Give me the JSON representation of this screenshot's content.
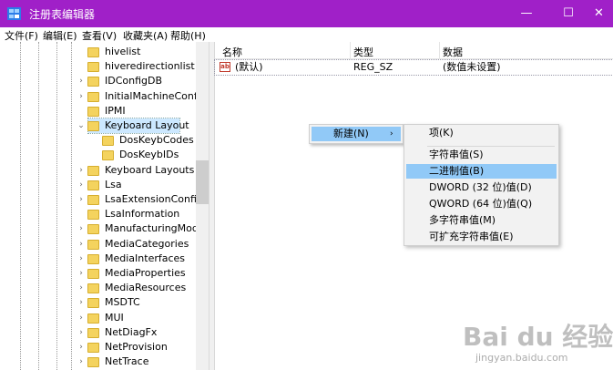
{
  "window": {
    "title": "注册表编辑器",
    "accent_color": "#a020c8",
    "minimize_glyph": "—",
    "maximize_glyph": "☐",
    "close_glyph": "✕"
  },
  "menubar": {
    "items": [
      "文件(F)",
      "编辑(E)",
      "查看(V)",
      "收藏夹(A)",
      "帮助(H)"
    ]
  },
  "tree": {
    "items": [
      {
        "label": "hivelist",
        "has_children": false
      },
      {
        "label": "hiveredirectionlist",
        "has_children": false
      },
      {
        "label": "IDConfigDB",
        "has_children": true
      },
      {
        "label": "InitialMachineConfig",
        "has_children": true
      },
      {
        "label": "IPMI",
        "has_children": false
      },
      {
        "label": "Keyboard Layout",
        "has_children": true,
        "expanded": true,
        "selected": true
      },
      {
        "label": "DosKeybCodes",
        "has_children": false,
        "child": true
      },
      {
        "label": "DosKeybIDs",
        "has_children": false,
        "child": true
      },
      {
        "label": "Keyboard Layouts",
        "has_children": true
      },
      {
        "label": "Lsa",
        "has_children": true
      },
      {
        "label": "LsaExtensionConfig",
        "has_children": true
      },
      {
        "label": "LsaInformation",
        "has_children": false
      },
      {
        "label": "ManufacturingMode",
        "has_children": true
      },
      {
        "label": "MediaCategories",
        "has_children": true
      },
      {
        "label": "MediaInterfaces",
        "has_children": true
      },
      {
        "label": "MediaProperties",
        "has_children": true
      },
      {
        "label": "MediaResources",
        "has_children": true
      },
      {
        "label": "MSDTC",
        "has_children": true
      },
      {
        "label": "MUI",
        "has_children": true
      },
      {
        "label": "NetDiagFx",
        "has_children": true
      },
      {
        "label": "NetProvision",
        "has_children": true
      },
      {
        "label": "NetTrace",
        "has_children": true
      }
    ]
  },
  "list": {
    "columns": [
      "名称",
      "类型",
      "数据"
    ],
    "rows": [
      {
        "icon": "ab",
        "name": "(默认)",
        "type": "REG_SZ",
        "data": "(数值未设置)"
      }
    ]
  },
  "context_menu": {
    "new_label": "新建(N)",
    "arrow": "›"
  },
  "submenu": {
    "items": [
      "项(K)",
      "字符串值(S)",
      "二进制值(B)",
      "DWORD (32 位)值(D)",
      "QWORD (64 位)值(Q)",
      "多字符串值(M)",
      "可扩充字符串值(E)"
    ],
    "hovered_index": 2
  },
  "watermark": {
    "logo": "Bai du 经验",
    "sub": "jingyan.baidu.com"
  }
}
